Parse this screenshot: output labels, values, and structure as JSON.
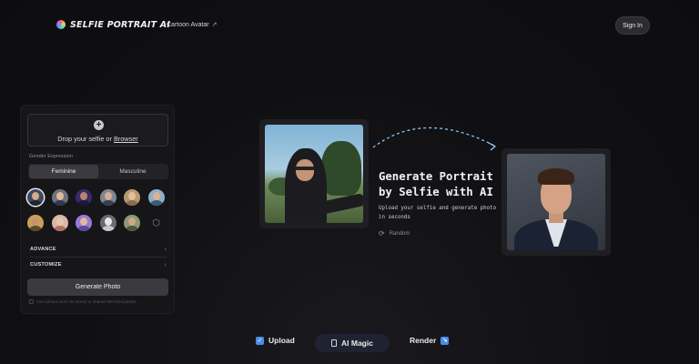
{
  "header": {
    "logo_text": "SELFIE PORTRAIT AI",
    "nav_link": "Cartoon Avatar",
    "signin_label": "Sign In"
  },
  "panel": {
    "drop_text_prefix": "Drop your selfie or",
    "drop_text_link": "Browser",
    "gender_label": "Gender Expression",
    "gender_options": [
      "Feminine",
      "Masculine"
    ],
    "gender_selected": "Feminine",
    "avatar_count": 11,
    "advance_label": "ADVANCE",
    "customize_label": "CUSTOMIZE",
    "generate_label": "Generate Photo",
    "note": "Your photos won't be stored or shared with third parties"
  },
  "hero": {
    "headline_line1": "Generate Portrait",
    "headline_line2": "by Selfie with AI",
    "subtext": "Upload your selfie and generate photo in seconds",
    "random_label": "Random"
  },
  "steps": {
    "upload": "Upload",
    "magic": "AI Magic",
    "render": "Render"
  },
  "colors": {
    "background": "#101013",
    "panel": "#161619",
    "accent": "#4a8de8",
    "arc": "#8fd0ff"
  },
  "icons": [
    "logo-icon",
    "external-link-icon",
    "plus-icon",
    "refresh-icon",
    "cube-icon",
    "chevron-left-icon",
    "upload-icon",
    "magic-icon",
    "render-icon"
  ]
}
